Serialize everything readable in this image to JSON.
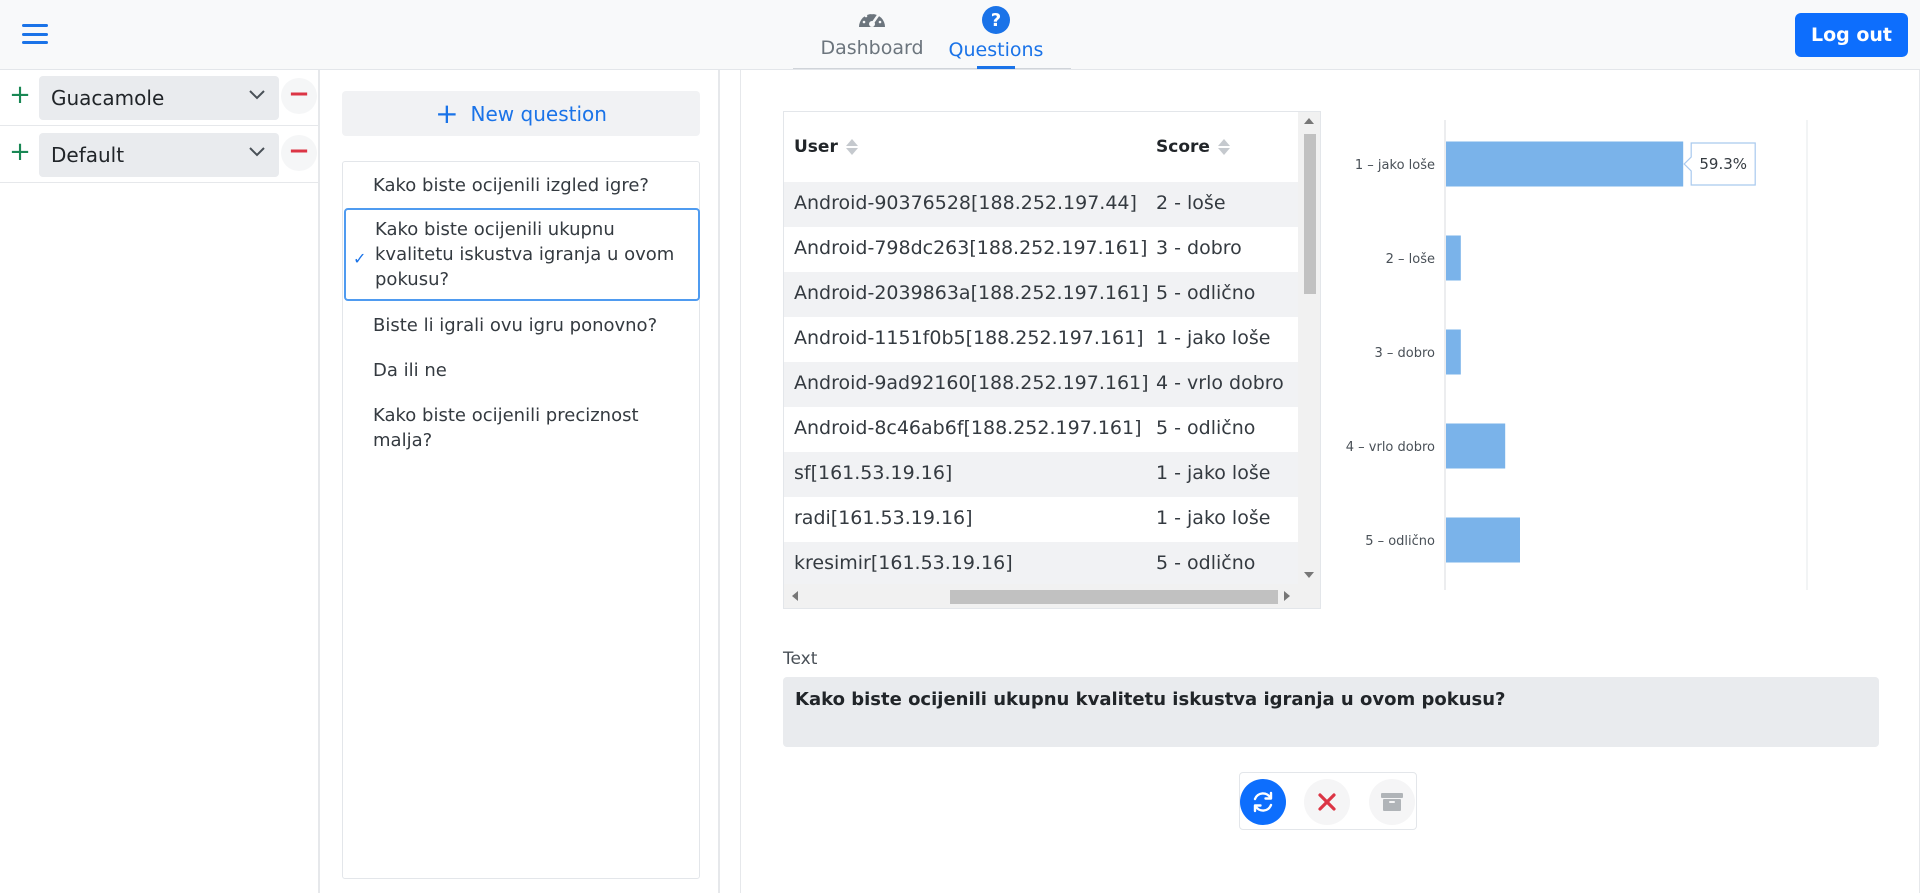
{
  "header": {
    "tabs": [
      {
        "label": "Dashboard",
        "icon": "gauge-icon"
      },
      {
        "label": "Questions",
        "icon": "question-circle-icon"
      }
    ],
    "active_tab": "Questions",
    "logout_label": "Log out",
    "accent_color": "#0d6efd"
  },
  "projects": [
    {
      "name": "Guacamole"
    },
    {
      "name": "Default"
    }
  ],
  "questions": {
    "new_button_label": "New question",
    "items": [
      {
        "text": "Kako biste ocijenili izgled igre?"
      },
      {
        "text": "Kako biste ocijenili ukupnu kvalitetu iskustva igranja u ovom pokusu?",
        "selected": true
      },
      {
        "text": "Biste li igrali ovu igru ponovno?"
      },
      {
        "text": "Da ili ne"
      },
      {
        "text": "Kako biste ocijenili preciznost malja?"
      }
    ]
  },
  "answers_table": {
    "columns": [
      "User",
      "Score"
    ],
    "rows": [
      {
        "user": "Android-90376528[188.252.197.44]",
        "score": "2 - loše"
      },
      {
        "user": "Android-798dc263[188.252.197.161]",
        "score": "3 - dobro"
      },
      {
        "user": "Android-2039863a[188.252.197.161]",
        "score": "5 - odlično"
      },
      {
        "user": "Android-1151f0b5[188.252.197.161]",
        "score": "1 - jako loše"
      },
      {
        "user": "Android-9ad92160[188.252.197.161]",
        "score": "4 - vrlo dobro"
      },
      {
        "user": "Android-8c46ab6f[188.252.197.161]",
        "score": "5 - odlično"
      },
      {
        "user": "sf[161.53.19.16]",
        "score": "1 - jako loše"
      },
      {
        "user": "radi[161.53.19.16]",
        "score": "1 - jako loše"
      },
      {
        "user": "kresimir[161.53.19.16]",
        "score": "5 - odlično"
      }
    ]
  },
  "chart_data": {
    "type": "bar",
    "orientation": "horizontal",
    "categories": [
      "1 – jako loše",
      "2 – loše",
      "3 – dobro",
      "4 – vrlo dobro",
      "5 – odlično"
    ],
    "values": [
      59.3,
      3.7,
      3.7,
      14.8,
      18.5
    ],
    "unit": "%",
    "xlim": [
      0,
      100
    ],
    "tooltip": {
      "category": "1 – jako loše",
      "label": "59.3%"
    },
    "bar_color": "#7ab3ea",
    "grid": false
  },
  "detail": {
    "text_label": "Text",
    "text_value": "Kako biste ocijenili ukupnu kvalitetu iskustva igranja u ovom pokusu?"
  },
  "actions": [
    {
      "icon": "refresh-icon",
      "color": "#0d6efd"
    },
    {
      "icon": "close-icon",
      "color": "#dc3545"
    },
    {
      "icon": "archive-icon",
      "color": "#b0b4b8"
    }
  ]
}
